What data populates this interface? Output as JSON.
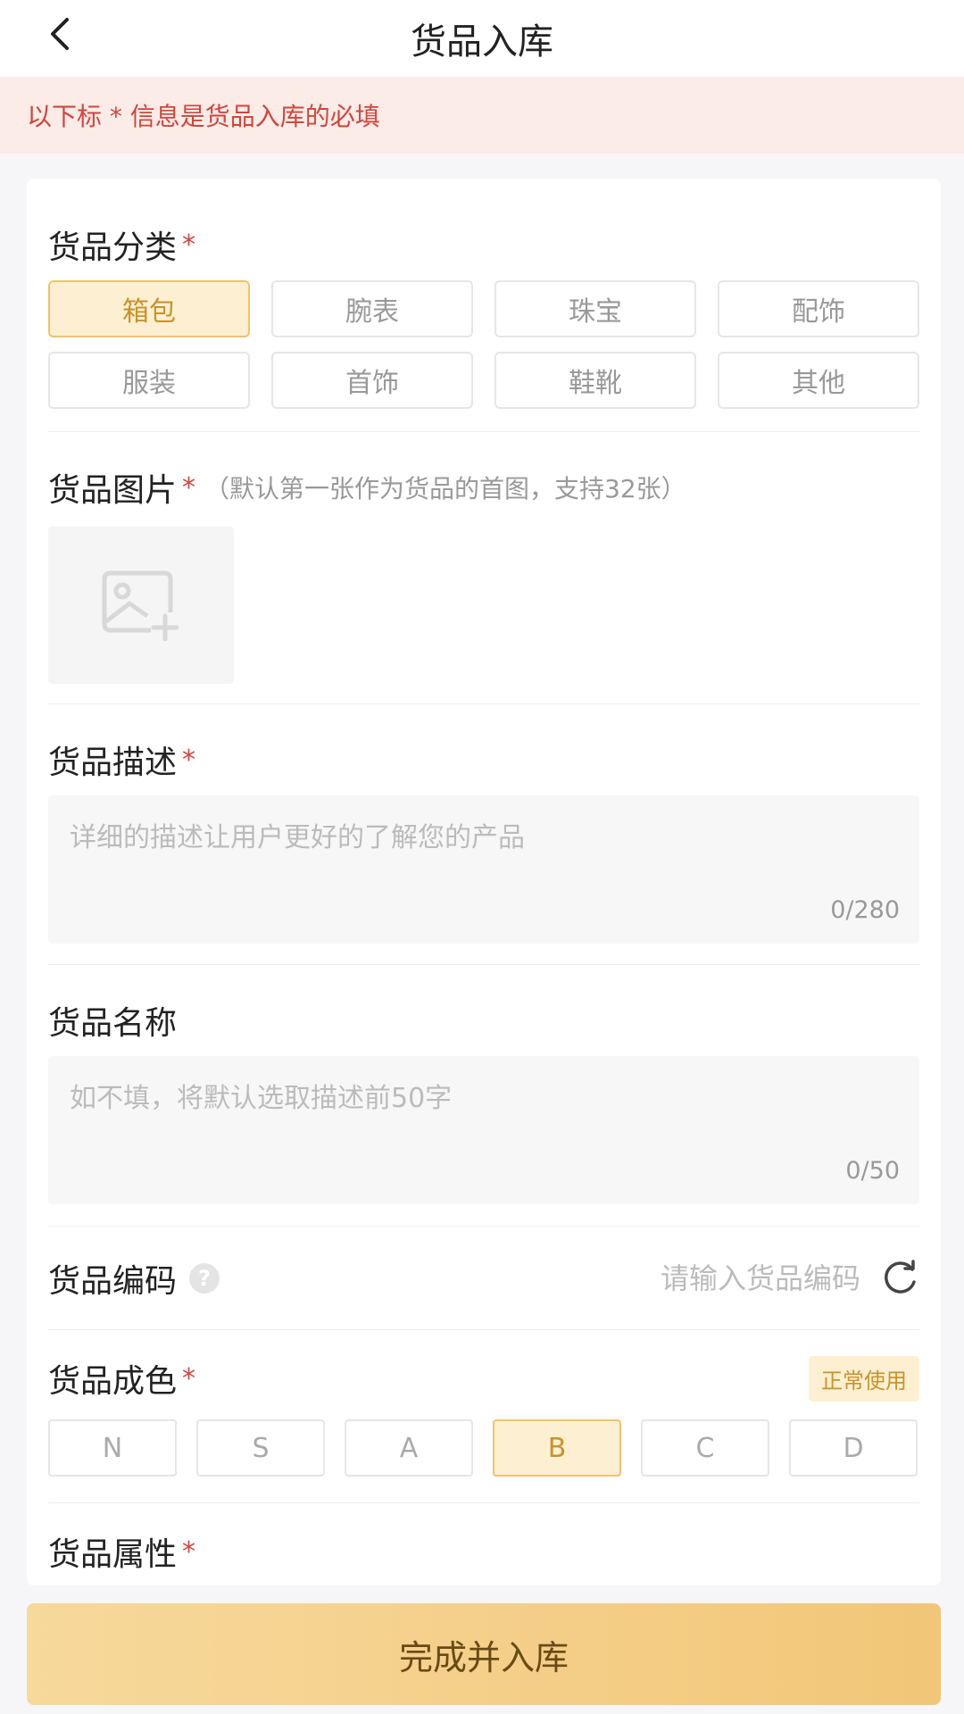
{
  "header": {
    "title": "货品入库",
    "back_icon": "chevron-left-icon"
  },
  "notice": {
    "text": "以下标 * 信息是货品入库的必填"
  },
  "category": {
    "title": "货品分类",
    "required_mark": "*",
    "options": [
      "箱包",
      "腕表",
      "珠宝",
      "配饰",
      "服装",
      "首饰",
      "鞋靴",
      "其他"
    ],
    "selected": "箱包"
  },
  "images": {
    "title": "货品图片",
    "required_mark": "*",
    "hint": "（默认第一张作为货品的首图，支持32张）",
    "upload_icon": "image-add-icon"
  },
  "description": {
    "title": "货品描述",
    "required_mark": "*",
    "placeholder": "详细的描述让用户更好的了解您的产品",
    "count": "0/280"
  },
  "name": {
    "title": "货品名称",
    "placeholder": "如不填，将默认选取描述前50字",
    "count": "0/50"
  },
  "code": {
    "title": "货品编码",
    "help_icon": "question-icon",
    "help_glyph": "?",
    "placeholder": "请输入货品编码",
    "refresh_icon": "refresh-icon"
  },
  "condition": {
    "title": "货品成色",
    "required_mark": "*",
    "badge": "正常使用",
    "grades": [
      "N",
      "S",
      "A",
      "B",
      "C",
      "D"
    ],
    "selected": "B"
  },
  "attributes": {
    "title": "货品属性",
    "required_mark": "*"
  },
  "submit": {
    "label": "完成并入库"
  },
  "colors": {
    "accent": "#c9932a",
    "accent_bg": "#fdf0d2",
    "required": "#d2453c",
    "button_gradient_start": "#f7d99c",
    "button_gradient_end": "#f2c678"
  }
}
